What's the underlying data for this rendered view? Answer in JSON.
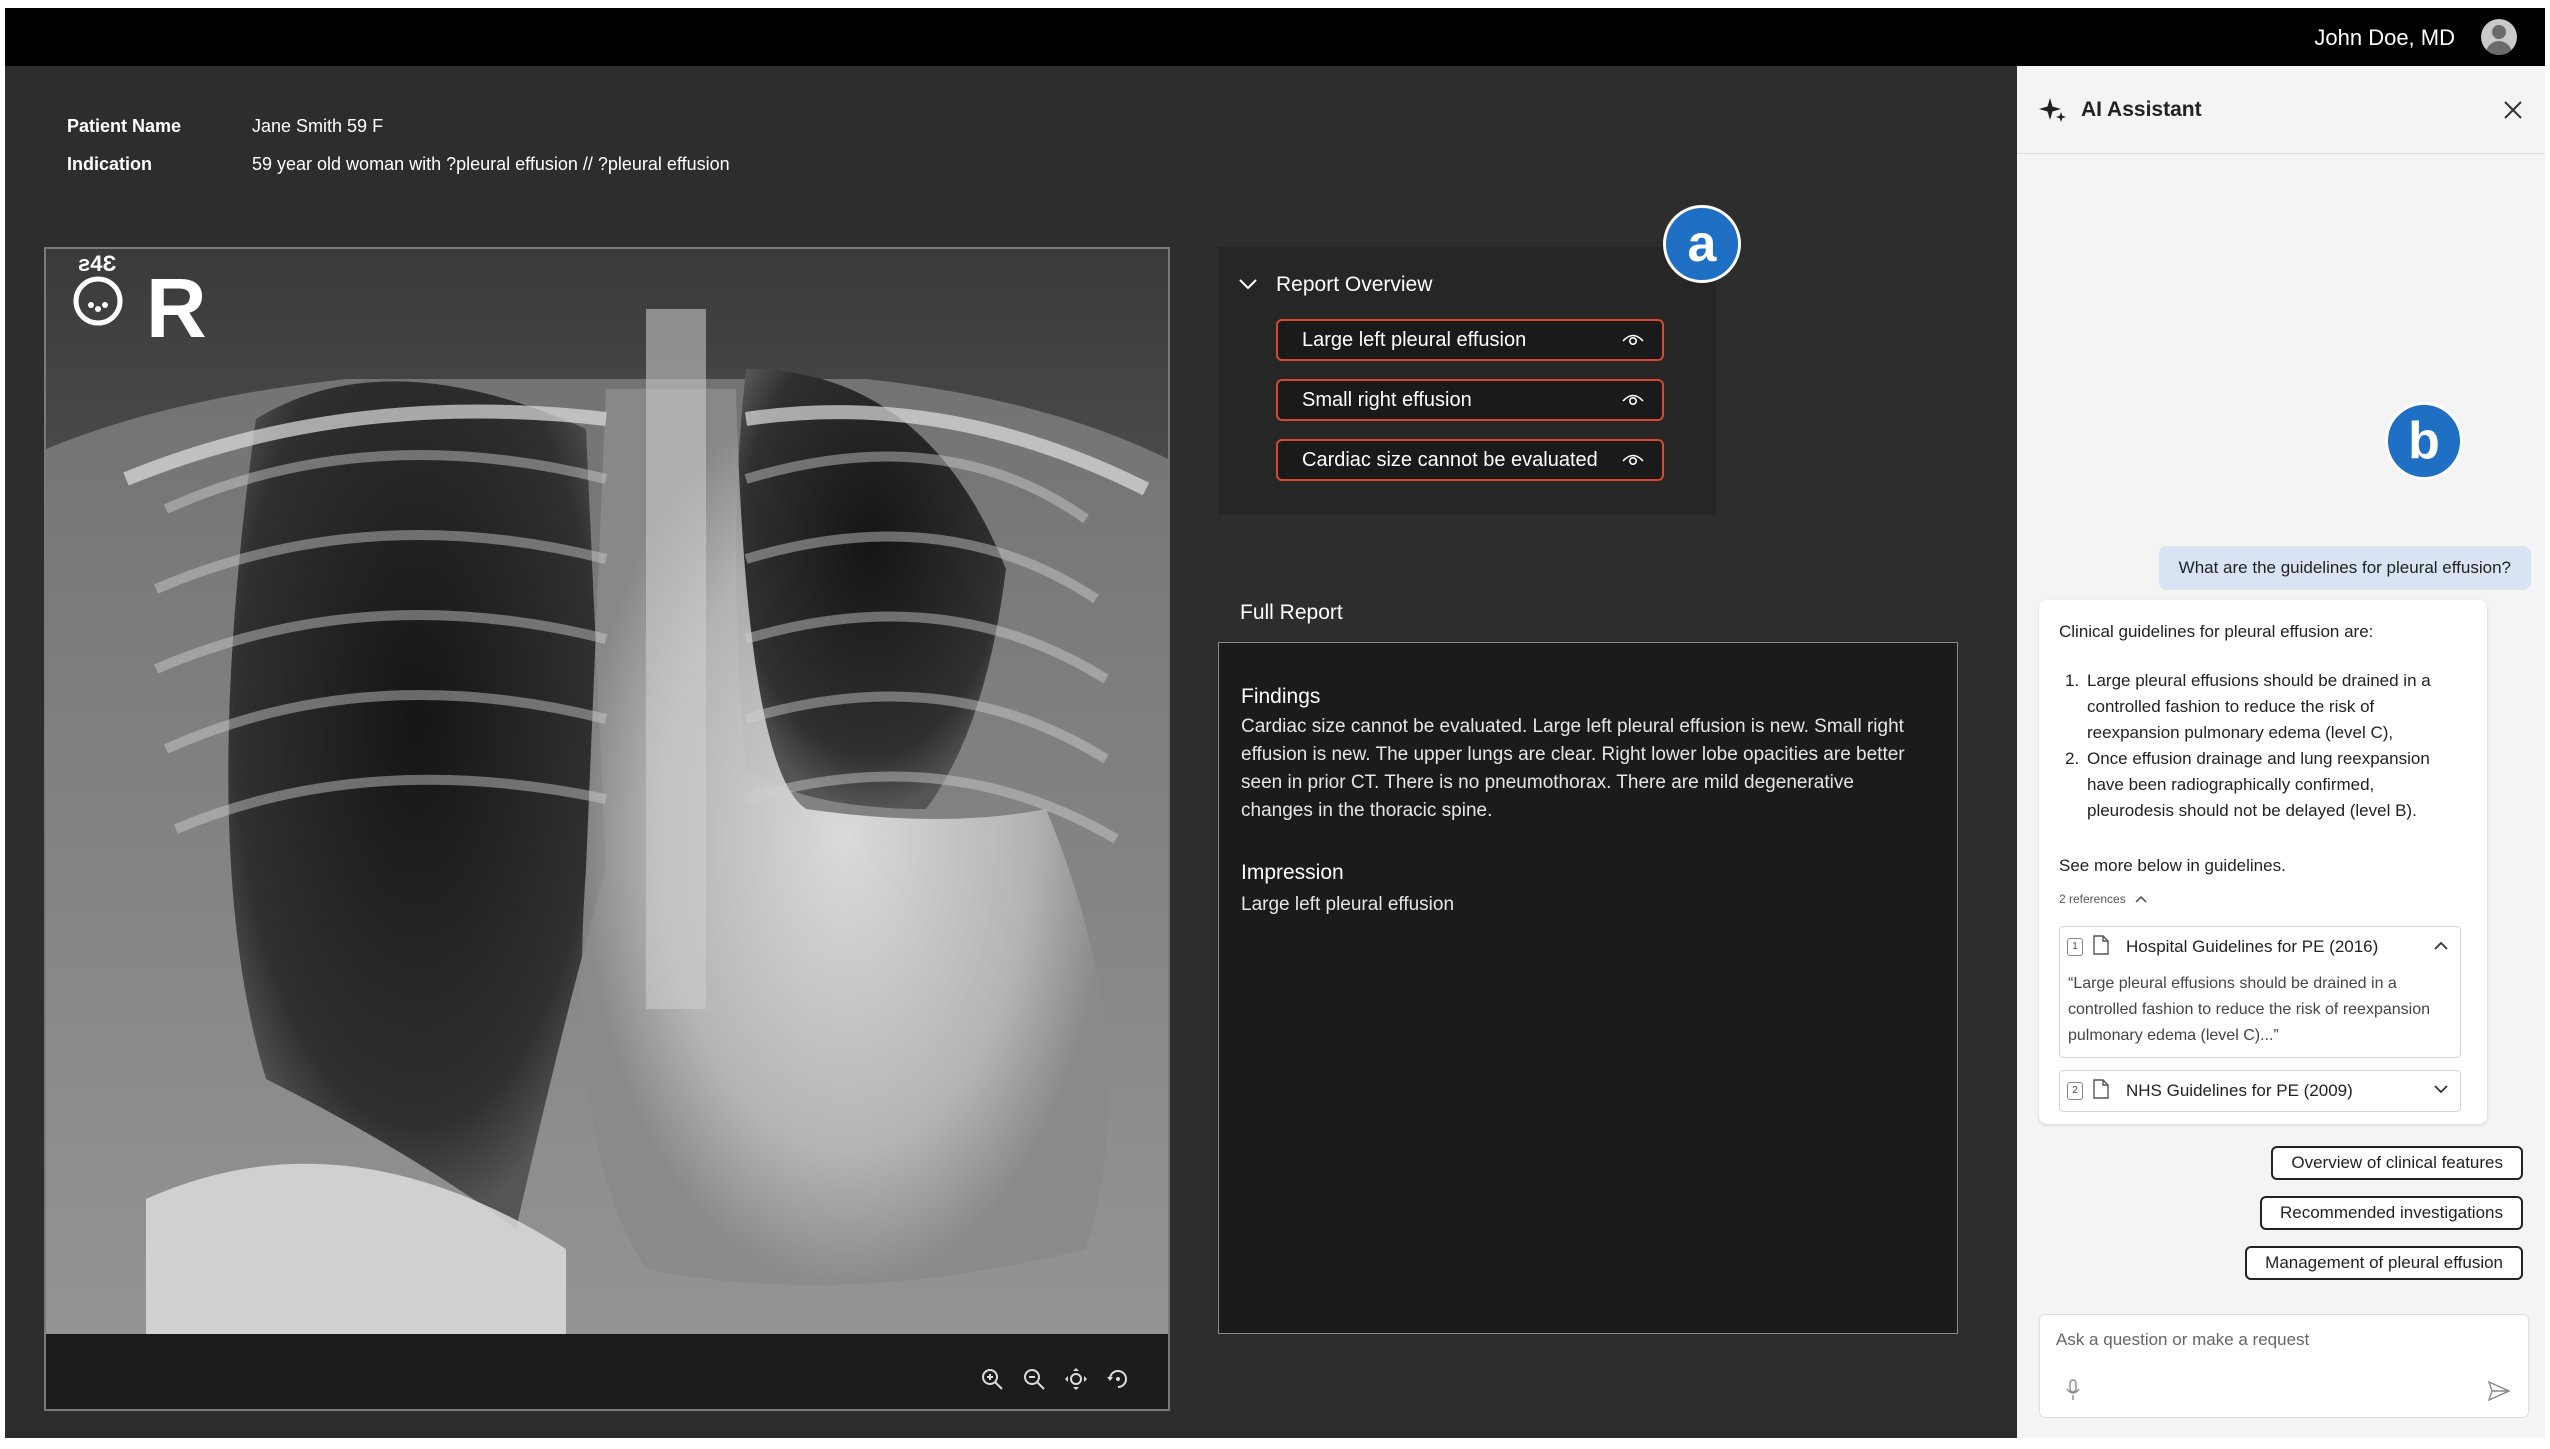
{
  "header": {
    "user_name": "John Doe, MD"
  },
  "patient": {
    "name_label": "Patient Name",
    "name_value": "Jane Smith 59 F",
    "indication_label": "Indication",
    "indication_value": "59 year old woman with ?pleural effusion // ?pleural effusion"
  },
  "viewer": {
    "tools": [
      "zoom-in-icon",
      "zoom-out-icon",
      "pan-icon",
      "rotate-icon"
    ]
  },
  "report_overview": {
    "title": "Report Overview",
    "findings": [
      "Large left pleural effusion",
      "Small right effusion",
      "Cardiac size cannot be evaluated"
    ]
  },
  "badges": {
    "a": "a",
    "b": "b"
  },
  "full_report": {
    "title": "Full Report",
    "findings_heading": "Findings",
    "findings_text": "Cardiac size cannot be evaluated. Large left pleural effusion is new. Small right effusion is new. The upper lungs are clear. Right lower lobe opacities are better seen in prior CT. There is no pneumothorax. There are mild degenerative changes in the thoracic spine.",
    "impression_heading": "Impression",
    "impression_text": "Large left pleural effusion"
  },
  "assistant": {
    "title": "AI Assistant",
    "user_message": "What are the guidelines for pleural effusion?",
    "response_intro": "Clinical guidelines for pleural effusion are:",
    "response_items": [
      "Large pleural effusions should be drained in a controlled fashion to reduce the risk of reexpansion pulmonary edema (level C),",
      "Once effusion drainage and lung reexpansion have been radiographically confirmed, pleurodesis should not be delayed (level B)."
    ],
    "see_more": "See more below in guidelines.",
    "references_label": "2 references",
    "references": [
      {
        "num": "1",
        "title": "Hospital Guidelines for PE (2016)",
        "quote": "“Large pleural effusions should be drained in a controlled fashion to reduce the risk of reexpansion pulmonary edema (level C)...”"
      },
      {
        "num": "2",
        "title": "NHS Guidelines for PE (2009)"
      }
    ],
    "suggestions": [
      "Overview of clinical features",
      "Recommended investigations",
      "Management of pleural effusion"
    ],
    "input_placeholder": "Ask a question or make a request"
  },
  "colors": {
    "finding_border": "#d6492f",
    "badge": "#1f6fc4",
    "user_bubble": "#d8e4f3"
  }
}
